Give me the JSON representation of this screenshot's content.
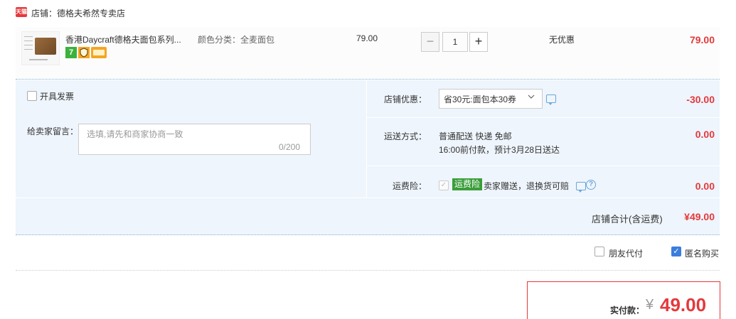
{
  "shop": {
    "badge": "天猫",
    "name": "店铺：德格夫希然专卖店"
  },
  "item": {
    "title": "香港Daycraft德格夫面包系列...",
    "spec": "颜色分类：全麦面包",
    "unit_price": "79.00",
    "quantity": "1",
    "discount_text": "无优惠",
    "line_total": "79.00",
    "tags": [
      "seven-day-return-icon",
      "guarantee-shield-icon",
      "credit-card-icon"
    ],
    "tag_seven": "7"
  },
  "options": {
    "invoice_label": "开具发票",
    "memo_label": "给卖家留言：",
    "memo_placeholder": "选填,请先和商家协商一致",
    "memo_count": "0/200",
    "shop_discount_label": "店铺优惠：",
    "coupon_selected": "省30元:面包本30券",
    "shop_discount_amount": "-30.00",
    "shipping_label": "运送方式：",
    "shipping_line1": "普通配送 快递 免邮",
    "shipping_line2": "16:00前付款，预计3月28日送达",
    "shipping_amount": "0.00",
    "insurance_label": "运费险：",
    "insurance_badge": "运费险",
    "insurance_desc": "卖家赠送，退换货可赔",
    "insurance_amount": "0.00",
    "help_glyph": "?",
    "subtotal_label": "店铺合计(含运费)",
    "subtotal_amount": "¥49.00"
  },
  "footer": {
    "friend_pay_label": "朋友代付",
    "anonymous_label": "匿名购买",
    "anonymous_checked": true,
    "pay_label": "实付款：",
    "currency": "¥",
    "pay_amount": "49.00"
  },
  "colors": {
    "accent_red": "#e4393c",
    "panel_blue": "#eef5fc",
    "check_blue": "#3b7ddd",
    "insurance_green": "#3a9e3a"
  }
}
